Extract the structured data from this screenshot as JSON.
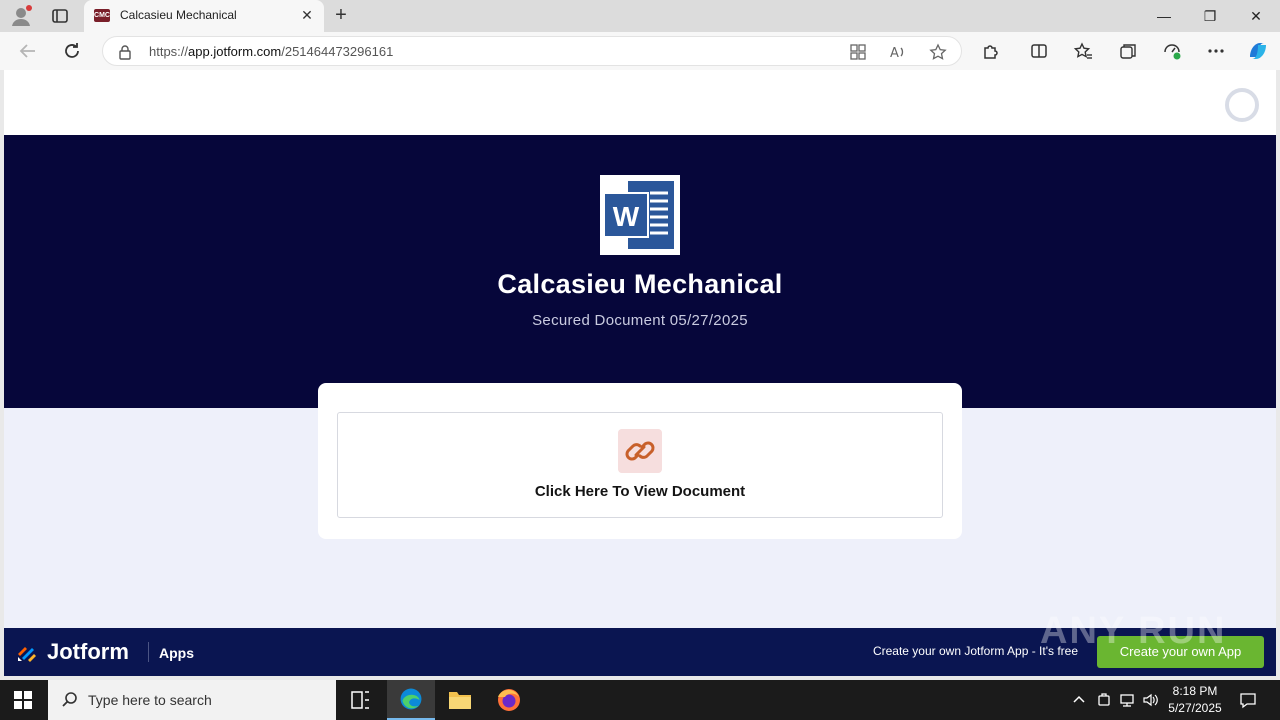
{
  "browser": {
    "tab_title": "Calcasieu Mechanical",
    "tab_favicon_text": "CMC",
    "url_host_prefix": "https://",
    "url_host": "app.jotform.com",
    "url_path": "/251464473296161"
  },
  "page": {
    "title": "Calcasieu Mechanical",
    "subtitle": "Secured Document 05/27/2025",
    "doc_logo_letter": "W",
    "card_button_label": "Click Here To View Document"
  },
  "footer": {
    "brand": "Jotform",
    "section": "Apps",
    "promo_text": "Create your own Jotform App - It's free",
    "cta_label": "Create your own App"
  },
  "watermark": "ANY RUN",
  "taskbar": {
    "search_placeholder": "Type here to search",
    "time": "8:18 PM",
    "date": "5/27/2025"
  },
  "colors": {
    "hero_bg": "#06063a",
    "footer_bg": "#0a1551",
    "cta_green": "#6ab631",
    "word_blue": "#2b579a",
    "link_orange": "#c8602a"
  },
  "icons": [
    "profile-icon",
    "tab-actions-icon",
    "close-icon",
    "plus-icon",
    "minimize-icon",
    "restore-icon",
    "back-icon",
    "refresh-icon",
    "lock-icon",
    "apps-icon",
    "read-aloud-icon",
    "favorite-icon",
    "extensions-icon",
    "split-screen-icon",
    "favorites-icon",
    "collections-icon",
    "performance-icon",
    "more-icon",
    "copilot-icon",
    "spinner-icon",
    "word-document-icon",
    "link-icon",
    "jotform-logo-icon",
    "windows-start-icon",
    "search-icon",
    "task-view-icon",
    "edge-icon",
    "file-explorer-icon",
    "firefox-icon",
    "chevron-up-icon",
    "security-icon",
    "network-icon",
    "volume-icon",
    "notification-icon"
  ]
}
